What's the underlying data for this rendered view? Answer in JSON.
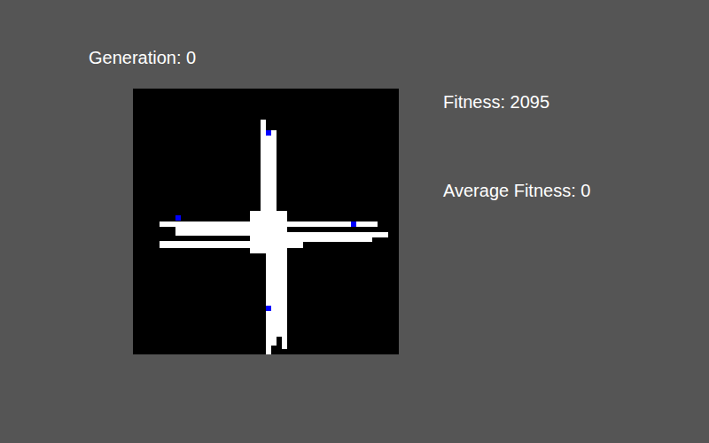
{
  "generation": "Generation: 0",
  "fitness": "Fitness: 2095",
  "average_fitness": "Average Fitness: 0"
}
